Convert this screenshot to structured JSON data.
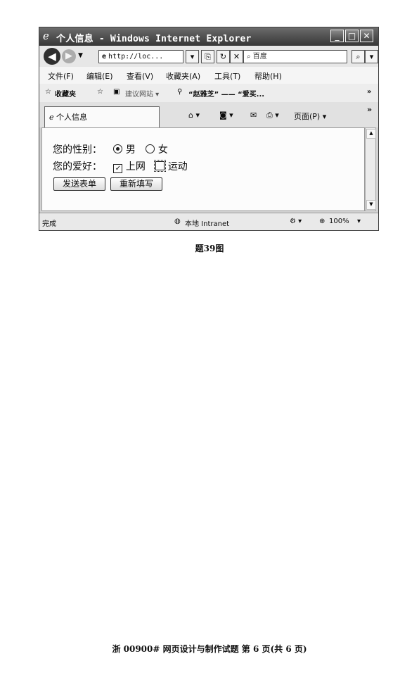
{
  "window": {
    "title": "个人信息 - Windows Internet Explorer",
    "controls": [
      "_",
      "□",
      "✕"
    ]
  },
  "nav": {
    "address": "http://loc...",
    "search_placeholder": "百度",
    "search_icon": "magnifier-icon"
  },
  "menu": [
    "文件(F)",
    "编辑(E)",
    "查看(V)",
    "收藏夹(A)",
    "工具(T)",
    "帮助(H)"
  ],
  "favorites": {
    "label": "收藏夹",
    "items": [
      "建议网站 ▾",
      "“赵雅芝” —— “爱买..."
    ]
  },
  "tab": {
    "title": "个人信息",
    "page_menu": "页面(P) ▾"
  },
  "form": {
    "gender_label": "您的性别：",
    "gender_options": [
      {
        "label": "男",
        "selected": true
      },
      {
        "label": "女",
        "selected": false
      }
    ],
    "hobby_label": "您的爱好：",
    "hobby_options": [
      {
        "label": "上网",
        "checked": true
      },
      {
        "label": "运动",
        "checked": false
      }
    ],
    "submit_label": "发送表单",
    "reset_label": "重新填写"
  },
  "status": {
    "text": "完成",
    "zone": "本地 Intranet",
    "zoom": "100%"
  },
  "caption": "题39图",
  "footer": "浙 00900# 网页设计与制作试题 第 6 页(共 6 页)"
}
